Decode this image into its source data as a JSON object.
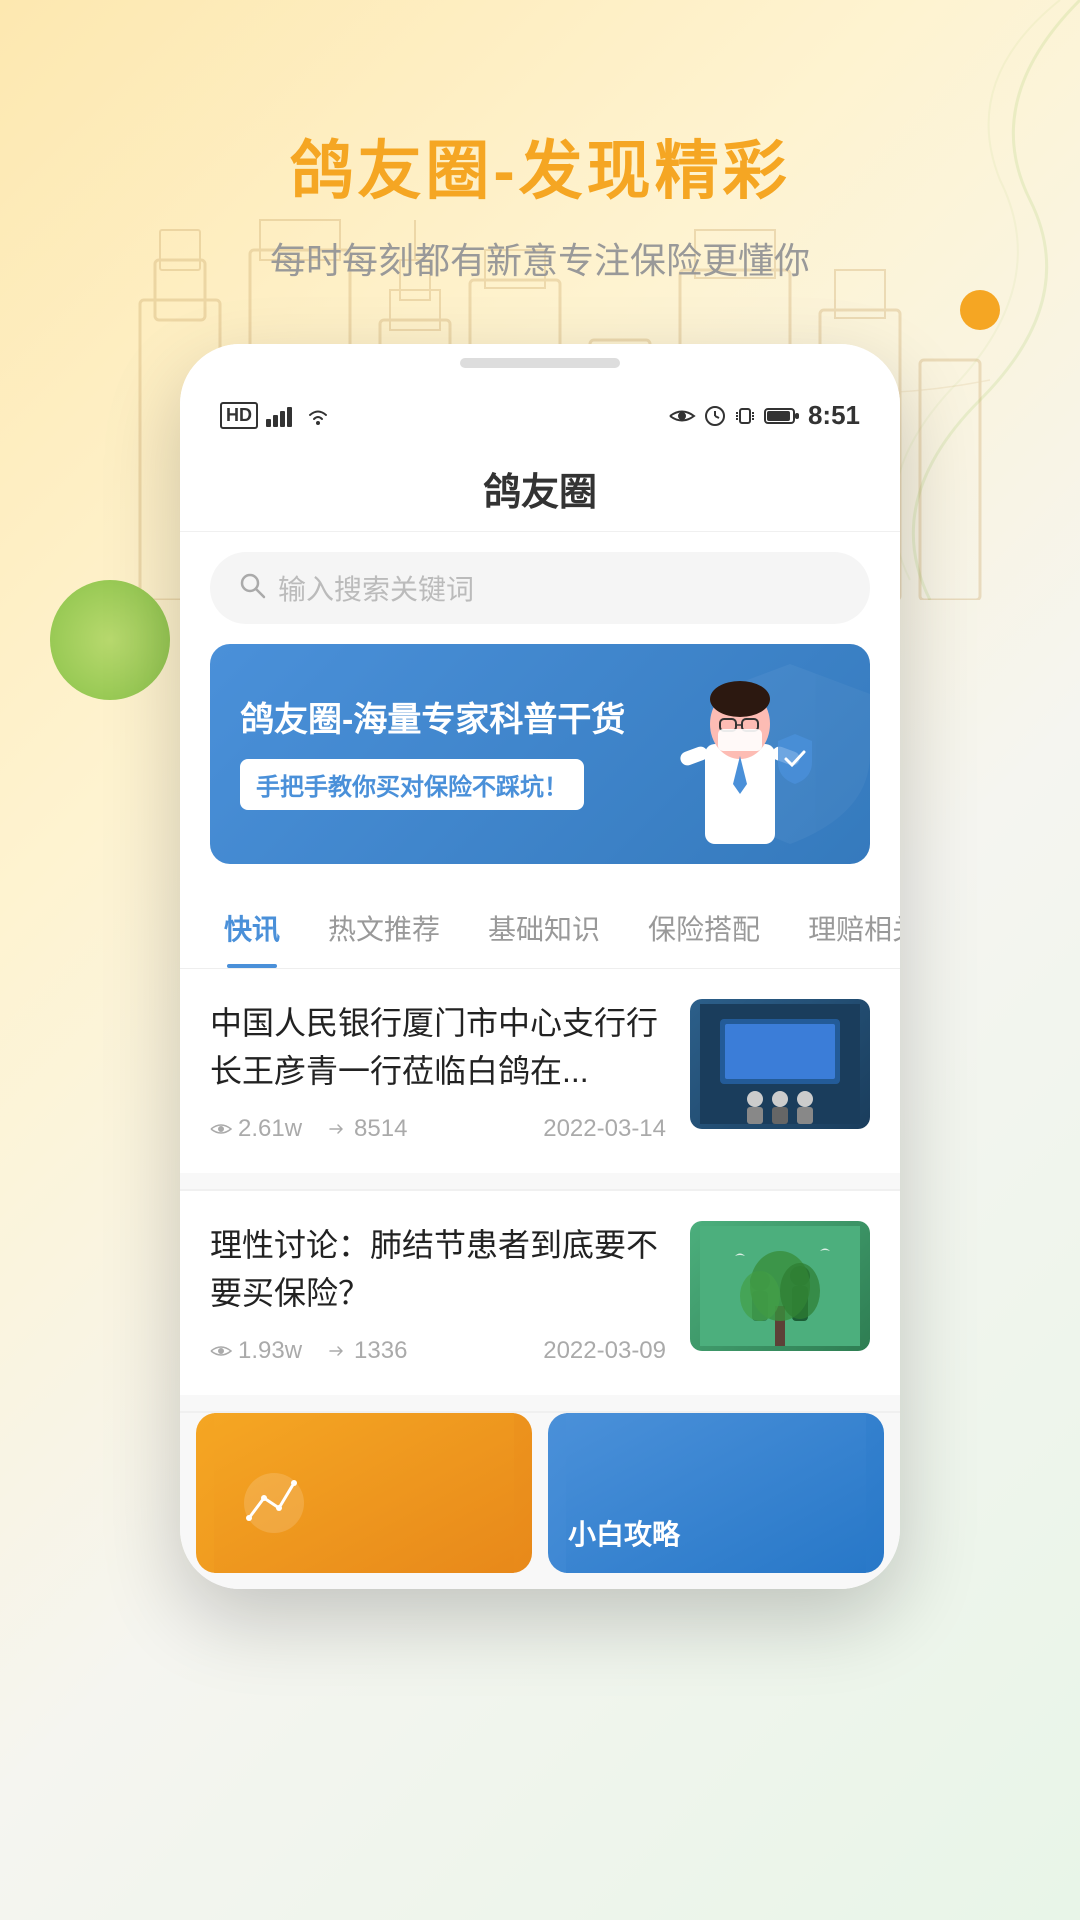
{
  "hero": {
    "title": "鸽友圈-发现精彩",
    "subtitle": "每时每刻都有新意专注保险更懂你"
  },
  "status_bar": {
    "left": "HD  4G  WiFi",
    "time": "8:51",
    "hd_label": "HD",
    "signal": "📶",
    "wifi": "📡"
  },
  "app": {
    "title": "鸽友圈"
  },
  "search": {
    "placeholder": "输入搜索关键词"
  },
  "banner": {
    "title": "鸽友圈-海量专家科普干货",
    "badge": "手把手教你买对保险不踩坑！"
  },
  "tabs": [
    {
      "label": "快讯",
      "active": true
    },
    {
      "label": "热文推荐",
      "active": false
    },
    {
      "label": "基础知识",
      "active": false
    },
    {
      "label": "保险搭配",
      "active": false
    },
    {
      "label": "理赔相关",
      "active": false
    }
  ],
  "news": [
    {
      "title": "中国人民银行厦门市中心支行行长王彦青一行莅临白鸽在...",
      "views": "2.61w",
      "shares": "8514",
      "date": "2022-03-14",
      "thumb_type": "meeting"
    },
    {
      "title": "理性讨论：肺结节患者到底要不要买保险？",
      "views": "1.93w",
      "shares": "1336",
      "date": "2022-03-09",
      "thumb_type": "plant"
    }
  ],
  "bottom_cards": [
    {
      "label": "",
      "type": "orange"
    },
    {
      "label": "小白攻略",
      "type": "blue"
    }
  ],
  "icons": {
    "search": "🔍",
    "eye": "👁",
    "share": "➤",
    "hd": "HD",
    "battery": "🔋"
  }
}
